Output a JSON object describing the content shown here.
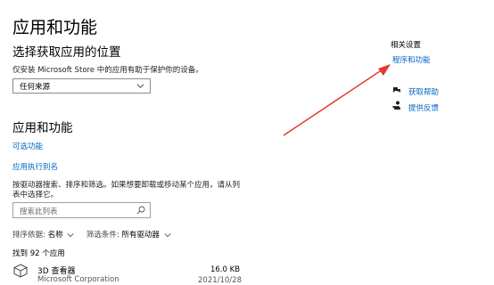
{
  "page": {
    "title": "应用和功能"
  },
  "install_location": {
    "heading": "选择获取应用的位置",
    "description": "仅安装 Microsoft Store 中的应用有助于保护你的设备。",
    "selected": "任何来源"
  },
  "apps_features": {
    "heading": "应用和功能",
    "optional_features_link": "可选功能",
    "app_aliases_link": "应用执行别名",
    "instructions": "按驱动器搜索、排序和筛选。如果想要卸载或移动某个应用，请从列表中选择它。",
    "search_placeholder": "搜索此列表",
    "sort_label": "排序依据:",
    "sort_value": "名称",
    "filter_label": "筛选条件:",
    "filter_value": "所有驱动器",
    "count": "找到 92 个应用",
    "apps": [
      {
        "name": "3D 查看器",
        "publisher": "Microsoft Corporation",
        "size": "16.0 KB",
        "date": "2021/10/28"
      }
    ]
  },
  "related": {
    "heading": "相关设置",
    "programs_link": "程序和功能",
    "help_link": "获取帮助",
    "feedback_link": "提供反馈"
  },
  "icons": {
    "chevron": "chevron-down-icon",
    "search": "search-icon",
    "help": "help-icon",
    "feedback": "feedback-icon",
    "app": "3d-viewer-icon"
  },
  "colors": {
    "link": "#0067c0",
    "annotation_arrow": "#e03b2e"
  }
}
